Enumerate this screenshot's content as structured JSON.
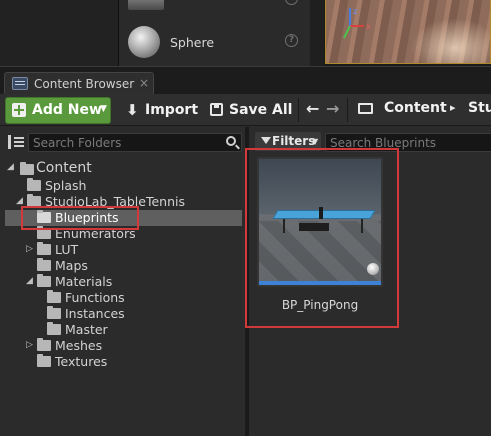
{
  "placement_panel": {
    "items": [
      {
        "label": "Sphere",
        "icon": "sphere-icon"
      }
    ]
  },
  "tab": {
    "label": "Content Browser",
    "close": "×"
  },
  "toolbar": {
    "add_new_label": "Add New",
    "import_label": "Import",
    "save_all_label": "Save All",
    "breadcrumb": [
      "Content",
      "Stu"
    ],
    "breadcrumb_sep": "▸",
    "add_new_color": "#5a9a3c"
  },
  "folders": {
    "search_placeholder": "Search Folders",
    "tree": {
      "content": "Content",
      "splash": "Splash",
      "project": "StudioLab_TableTennis",
      "blueprints": "Blueprints",
      "enumerators": "Enumerators",
      "lut": "LUT",
      "maps": "Maps",
      "materials": "Materials",
      "functions": "Functions",
      "instances": "Instances",
      "master": "Master",
      "meshes": "Meshes",
      "textures": "Textures"
    },
    "selected": "Blueprints"
  },
  "assets": {
    "filters_label": "Filters",
    "search_placeholder": "Search Blueprints",
    "items": [
      {
        "name": "BP_PingPong",
        "type_color": "#3d82d6"
      }
    ]
  },
  "highlight_color": "#d23a3a"
}
